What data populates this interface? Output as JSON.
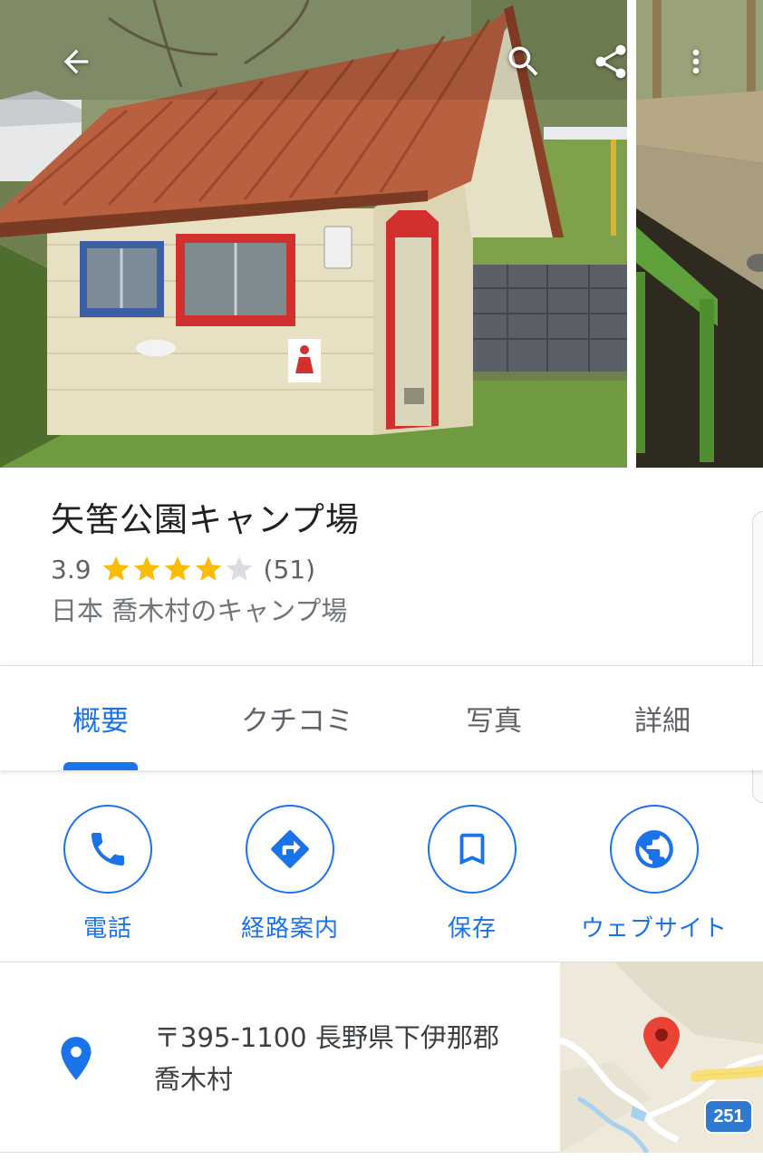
{
  "photos": {
    "main_alt": "",
    "side_alt": ""
  },
  "top_bar": {
    "back_icon": "arrow-back-icon",
    "search_icon": "search-icon",
    "share_icon": "share-icon",
    "more_icon": "more-vert-icon"
  },
  "place": {
    "title": "矢筈公園キャンプ場",
    "rating": "3.9",
    "rating_stars": 3.9,
    "review_count": "(51)",
    "subtitle": "日本 喬木村のキャンプ場"
  },
  "tabs": [
    {
      "label": "概要",
      "active": true
    },
    {
      "label": "クチコミ",
      "active": false
    },
    {
      "label": "写真",
      "active": false
    },
    {
      "label": "詳細",
      "active": false
    }
  ],
  "actions": [
    {
      "label": "電話",
      "icon": "phone-icon"
    },
    {
      "label": "経路案内",
      "icon": "directions-icon"
    },
    {
      "label": "保存",
      "icon": "bookmark-icon"
    },
    {
      "label": "ウェブサイト",
      "icon": "globe-icon"
    }
  ],
  "address": {
    "line1": "〒395-1100 長野県下伊那郡",
    "line2": "喬木村",
    "icon": "location-pin-icon"
  },
  "map": {
    "route_number": "251"
  },
  "colors": {
    "accent": "#1a73e8",
    "star": "#fbbc04",
    "star_empty": "#dadce0",
    "pin_red": "#ea4335"
  }
}
